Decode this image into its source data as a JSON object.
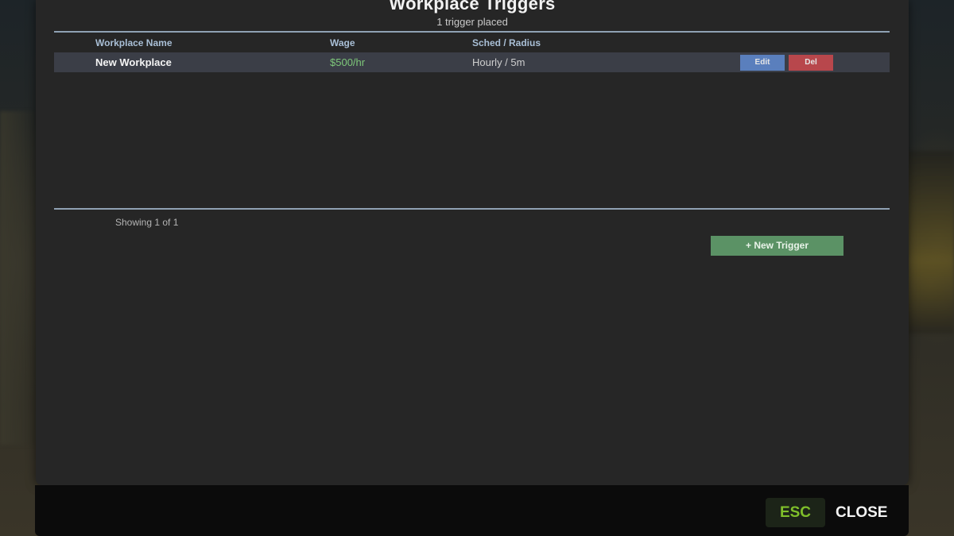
{
  "dialog": {
    "title": "Workplace Triggers",
    "subtitle": "1 trigger placed"
  },
  "table": {
    "columns": [
      "Workplace Name",
      "Wage",
      "Sched / Radius"
    ],
    "rows": [
      {
        "name": "New Workplace",
        "wage": "$500/hr",
        "sched_radius": "Hourly / 5m",
        "edit_label": "Edit",
        "delete_label": "Del"
      }
    ]
  },
  "pagination": {
    "text": "Showing 1 of 1"
  },
  "actions": {
    "new_trigger_label": "+ New Trigger"
  },
  "footer": {
    "esc_key": "ESC",
    "close_label": "CLOSE"
  },
  "colors": {
    "panel": "#262626",
    "header_text": "#a9bfd6",
    "wage_green": "#7ec87a",
    "edit_blue": "#5a7fbd",
    "delete_red": "#b8474c",
    "new_button_green": "#5b9265",
    "esc_green": "#7fbf2a"
  }
}
